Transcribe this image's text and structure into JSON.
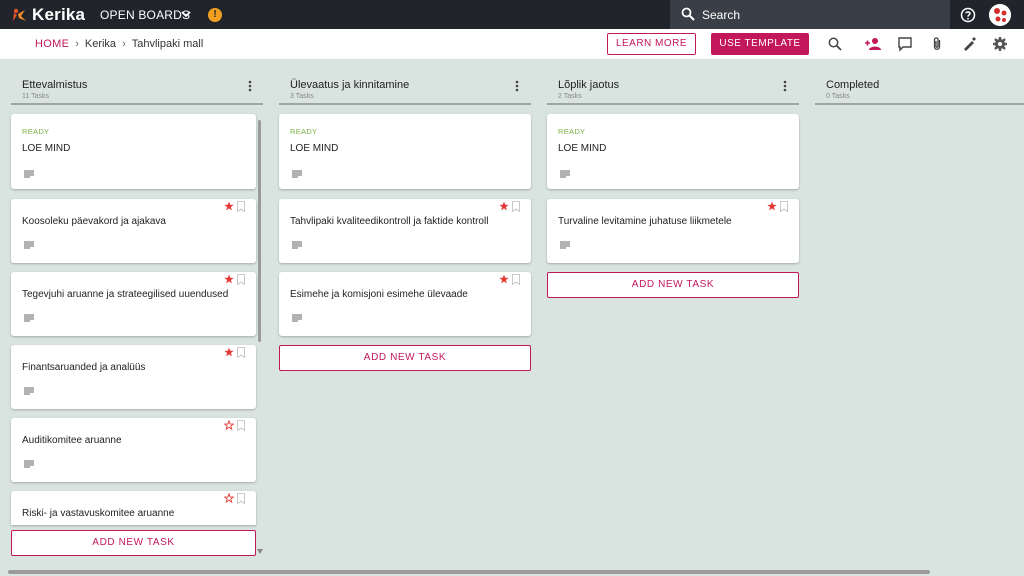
{
  "brand": {
    "name": "Kerika"
  },
  "topbar": {
    "open_boards_label": "OPEN BOARDS",
    "warning_badge": "!",
    "search_placeholder": "Search"
  },
  "breadcrumb": {
    "home": "HOME",
    "items": [
      "Kerika",
      "Tahvlipaki mall"
    ]
  },
  "toolbar": {
    "learn_more_label": "LEARN MORE",
    "use_template_label": "USE TEMPLATE",
    "icons": [
      "search-icon",
      "add-person-icon",
      "chat-icon",
      "attachment-icon",
      "pen-icon",
      "gear-icon"
    ]
  },
  "colors": {
    "accent": "#c2185b",
    "ready": "#7cb342",
    "star": "#e53935",
    "topbar": "#21252b",
    "board_bg": "#d9e3e0"
  },
  "columns": [
    {
      "title": "Ettevalmistus",
      "count": "11 Tasks",
      "cards": [
        {
          "status": "READY",
          "title": "LOE MIND",
          "starred": false
        },
        {
          "title": "Koosoleku päevakord ja ajakava",
          "starred": true
        },
        {
          "title": "Tegevjuhi aruanne ja strateegilised uuendused",
          "starred": true
        },
        {
          "title": "Finantsaruanded ja analüüs",
          "starred": true
        },
        {
          "title": "Auditikomitee aruanne",
          "starred": false,
          "star_outline": true
        },
        {
          "title": "Riski- ja vastavuskomitee aruanne",
          "starred": false,
          "star_outline": true
        }
      ],
      "add_label": "ADD NEW TASK"
    },
    {
      "title": "Ülevaatus ja kinnitamine",
      "count": "3 Tasks",
      "cards": [
        {
          "status": "READY",
          "title": "LOE MIND"
        },
        {
          "title": "Tahvlipaki kvaliteedikontroll ja faktide kontroll",
          "starred": true
        },
        {
          "title": "Esimehe ja komisjoni esimehe ülevaade",
          "starred": true
        }
      ],
      "add_label": "ADD NEW TASK"
    },
    {
      "title": "Lõplik jaotus",
      "count": "2 Tasks",
      "cards": [
        {
          "status": "READY",
          "title": "LOE MIND"
        },
        {
          "title": "Turvaline levitamine juhatuse liikmetele",
          "starred": true
        }
      ],
      "add_label": "ADD NEW TASK"
    },
    {
      "title": "Completed",
      "count": "0 Tasks",
      "cards": []
    }
  ]
}
